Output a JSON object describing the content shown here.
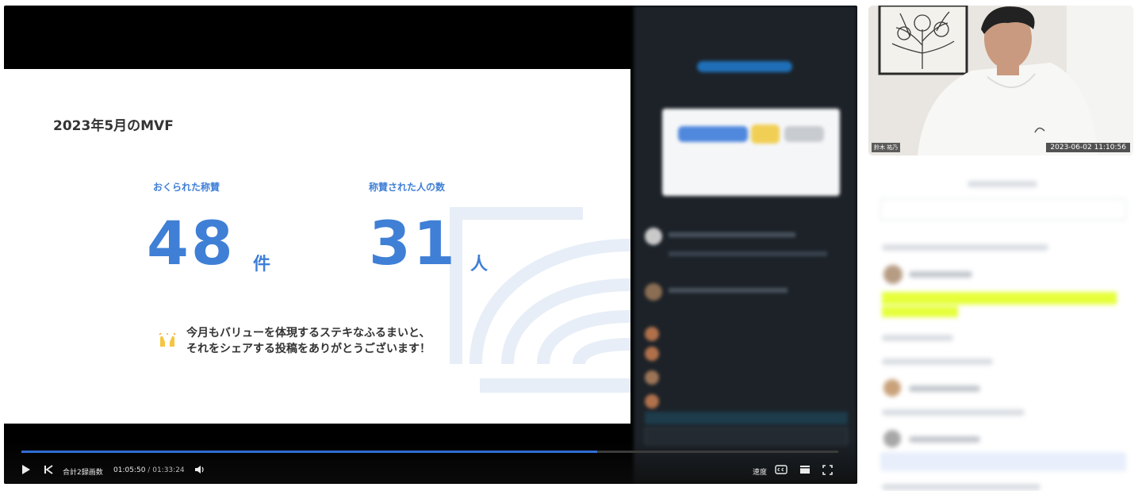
{
  "slide": {
    "title": "2023年5月のMVF",
    "metric1": {
      "label": "おくられた称賛",
      "value": "48",
      "unit": "件"
    },
    "metric2": {
      "label": "称賛された人の数",
      "value": "31",
      "unit": "人"
    },
    "message_line1": "今月もバリューを体現するステキなふるまいと、",
    "message_line2": "それをシェアする投稿をありがとうございます！",
    "emoji": "raised-hands-emoji"
  },
  "player": {
    "view_count": "合計2録画数",
    "current_time": "01:05:50",
    "separator": "/",
    "total_time": "01:33:24",
    "progress": 0.705,
    "speed_label": "速度",
    "icons": [
      "play-icon",
      "skip-back-icon",
      "volume-icon",
      "captions-icon",
      "theater-icon",
      "fullscreen-icon"
    ],
    "accent_color": "#2f6fd6"
  },
  "camera": {
    "name_tag": "鈴木 祐乃",
    "timestamp": "2023-06-02 11:10:56"
  },
  "colors": {
    "slide_accent": "#3f7fd6",
    "highlight": "#e6ff3a"
  }
}
